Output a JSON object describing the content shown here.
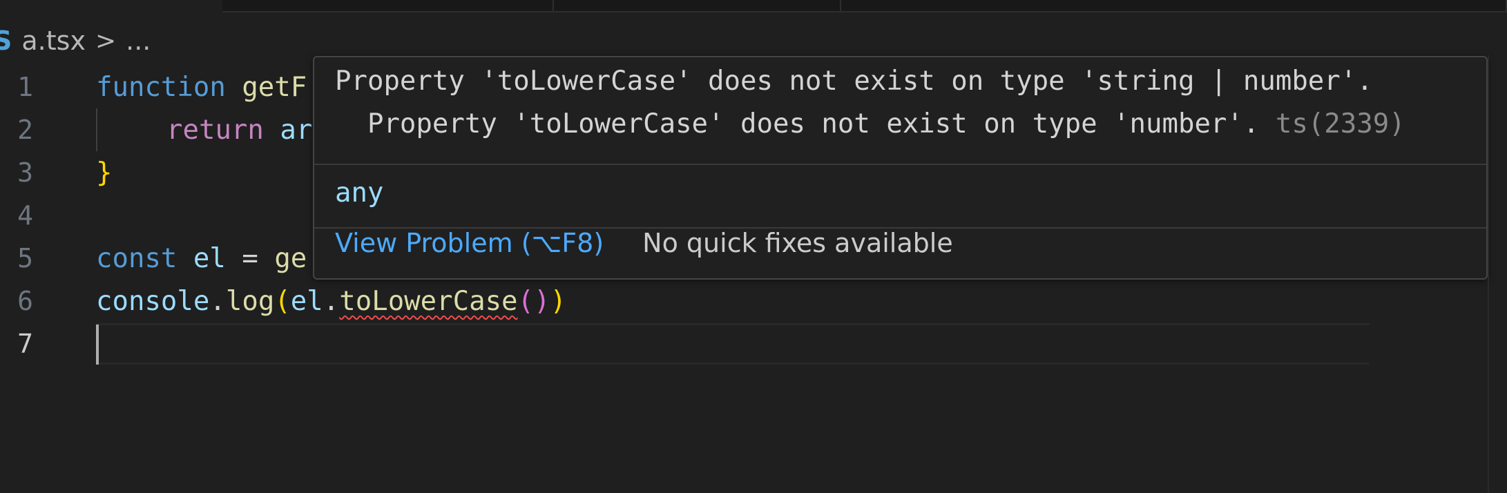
{
  "breadcrumb": {
    "file_icon": "S",
    "file_name": "a.tsx",
    "separator": ">",
    "symbol": "..."
  },
  "editor": {
    "lines": [
      {
        "number": "1",
        "tokens": [
          "function",
          " ",
          "getF"
        ]
      },
      {
        "number": "2",
        "tokens": [
          "return",
          " ",
          "ar"
        ]
      },
      {
        "number": "3",
        "tokens": [
          "}"
        ]
      },
      {
        "number": "4",
        "tokens": []
      },
      {
        "number": "5",
        "tokens": [
          "const",
          " ",
          "el",
          " = ",
          "ge"
        ]
      },
      {
        "number": "6",
        "tokens": [
          "console",
          ".",
          "log",
          "(",
          "el",
          ".",
          "toLowerCase",
          "()",
          ")"
        ]
      },
      {
        "number": "7",
        "tokens": []
      }
    ]
  },
  "hover": {
    "error_line_1": "Property 'toLowerCase' does not exist on type 'string | number'.",
    "error_line_2": "  Property 'toLowerCase' does not exist on type 'number'. ",
    "error_code": "ts(2339)",
    "type_text": "any",
    "view_problem_label": "View Problem (⌥F8)",
    "no_fixes_label": "No quick fixes available"
  },
  "colors": {
    "background": "#1f1f1f",
    "keyword": "#569cd6",
    "return_keyword": "#c586c0",
    "function_name": "#dcdcaa",
    "variable": "#9cdcfe",
    "error_squiggle": "#f14c4c",
    "link": "#4daafc"
  }
}
